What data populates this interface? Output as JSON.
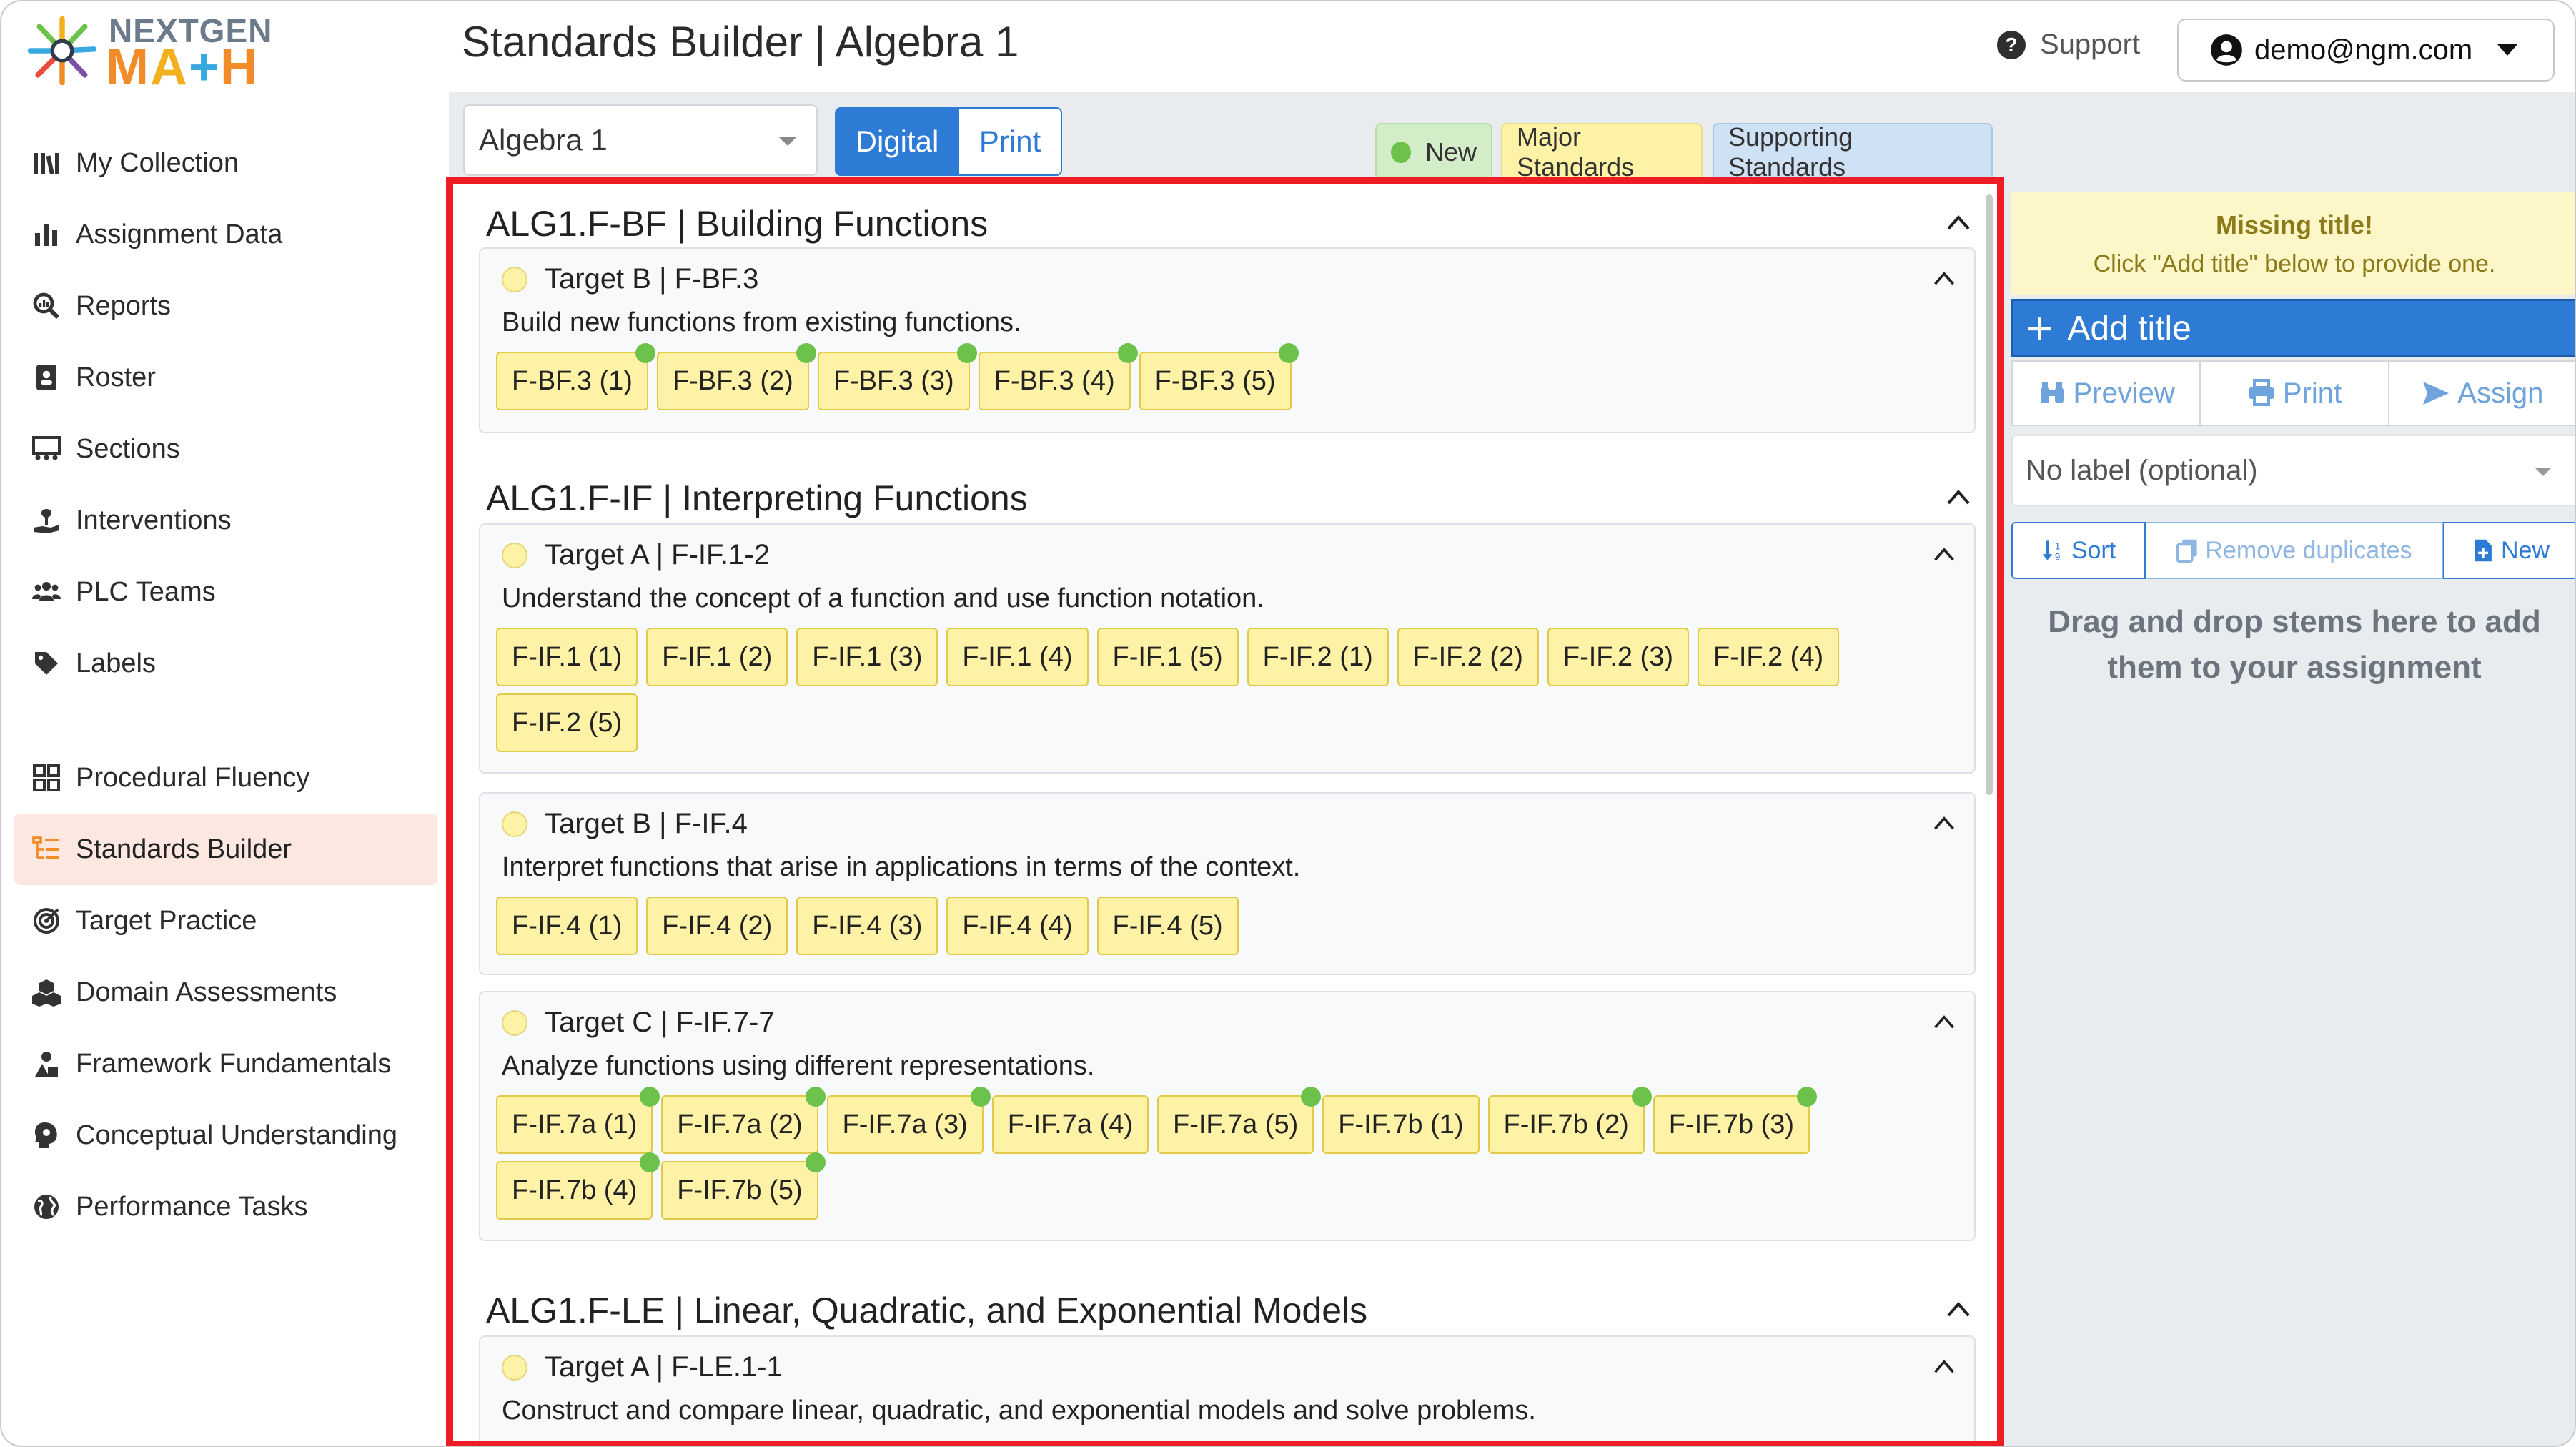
{
  "brand": {
    "line1": "NEXTGEN",
    "line2": [
      "M",
      "A",
      "+",
      "H"
    ]
  },
  "sidebar": {
    "group1": [
      {
        "label": "My Collection",
        "icon": "books-icon"
      },
      {
        "label": "Assignment Data",
        "icon": "bar-chart-icon"
      },
      {
        "label": "Reports",
        "icon": "magnifier-chart-icon"
      },
      {
        "label": "Roster",
        "icon": "id-card-icon"
      },
      {
        "label": "Sections",
        "icon": "sections-icon"
      },
      {
        "label": "Interventions",
        "icon": "hand-seedling-icon"
      },
      {
        "label": "PLC Teams",
        "icon": "users-icon"
      },
      {
        "label": "Labels",
        "icon": "tag-icon"
      }
    ],
    "group2": [
      {
        "label": "Procedural Fluency",
        "icon": "grid-icon"
      },
      {
        "label": "Standards Builder",
        "icon": "list-tree-icon",
        "active": true
      },
      {
        "label": "Target Practice",
        "icon": "target-icon"
      },
      {
        "label": "Domain Assessments",
        "icon": "cubes-icon"
      },
      {
        "label": "Framework Fundamentals",
        "icon": "shapes-icon"
      },
      {
        "label": "Conceptual Understanding",
        "icon": "head-gears-icon"
      },
      {
        "label": "Performance Tasks",
        "icon": "globe-icon"
      }
    ]
  },
  "header": {
    "title": "Standards Builder | Algebra 1",
    "support_label": "Support",
    "user_email": "demo@ngm.com"
  },
  "toolbar": {
    "course": "Algebra 1",
    "mode_digital": "Digital",
    "mode_print": "Print",
    "legend_new": "New",
    "legend_major": "Major Standards",
    "legend_supporting": "Supporting Standards"
  },
  "domains": [
    {
      "title": "ALG1.F-BF | Building Functions",
      "targets": [
        {
          "title": "Target B | F-BF.3",
          "description": "Build new functions from existing functions.",
          "chips": [
            {
              "label": "F-BF.3 (1)",
              "new": true
            },
            {
              "label": "F-BF.3 (2)",
              "new": true
            },
            {
              "label": "F-BF.3 (3)",
              "new": true
            },
            {
              "label": "F-BF.3 (4)",
              "new": true
            },
            {
              "label": "F-BF.3 (5)",
              "new": true
            }
          ]
        }
      ]
    },
    {
      "title": "ALG1.F-IF | Interpreting Functions",
      "targets": [
        {
          "title": "Target A | F-IF.1-2",
          "description": "Understand the concept of a function and use function notation.",
          "chips": [
            {
              "label": "F-IF.1 (1)"
            },
            {
              "label": "F-IF.1 (2)"
            },
            {
              "label": "F-IF.1 (3)"
            },
            {
              "label": "F-IF.1 (4)"
            },
            {
              "label": "F-IF.1 (5)"
            },
            {
              "label": "F-IF.2 (1)"
            },
            {
              "label": "F-IF.2 (2)"
            },
            {
              "label": "F-IF.2 (3)"
            },
            {
              "label": "F-IF.2 (4)"
            },
            {
              "label": "F-IF.2 (5)"
            }
          ]
        },
        {
          "title": "Target B | F-IF.4",
          "description": "Interpret functions that arise in applications in terms of the context.",
          "chips": [
            {
              "label": "F-IF.4 (1)"
            },
            {
              "label": "F-IF.4 (2)"
            },
            {
              "label": "F-IF.4 (3)"
            },
            {
              "label": "F-IF.4 (4)"
            },
            {
              "label": "F-IF.4 (5)"
            }
          ]
        },
        {
          "title": "Target C | F-IF.7-7",
          "description": "Analyze functions using different representations.",
          "chips": [
            {
              "label": "F-IF.7a (1)",
              "new": true
            },
            {
              "label": "F-IF.7a (2)",
              "new": true
            },
            {
              "label": "F-IF.7a (3)",
              "new": true
            },
            {
              "label": "F-IF.7a (4)"
            },
            {
              "label": "F-IF.7a (5)",
              "new": true
            },
            {
              "label": "F-IF.7b (1)"
            },
            {
              "label": "F-IF.7b (2)",
              "new": true
            },
            {
              "label": "F-IF.7b (3)",
              "new": true
            },
            {
              "label": "F-IF.7b (4)",
              "new": true
            },
            {
              "label": "F-IF.7b (5)",
              "new": true
            }
          ]
        }
      ]
    },
    {
      "title": "ALG1.F-LE | Linear, Quadratic, and Exponential Models",
      "targets": [
        {
          "title": "Target A | F-LE.1-1",
          "description": "Construct and compare linear, quadratic, and exponential models and solve problems.",
          "chips": []
        }
      ]
    }
  ],
  "assignment": {
    "missing_title": "Missing title!",
    "missing_hint": "Click \"Add title\" below to provide one.",
    "add_title": "Add title",
    "preview": "Preview",
    "print": "Print",
    "assign": "Assign",
    "label_placeholder": "No label (optional)",
    "sort": "Sort",
    "remove_duplicates": "Remove duplicates",
    "new": "New",
    "drop_hint_1": "Drag and drop stems here to add",
    "drop_hint_2": "them to your assignment"
  },
  "colors": {
    "primary": "#2e7bd6",
    "major": "#fdf2a5",
    "supporting": "#cfe2f5",
    "new": "#6cc24a",
    "highlight": "#ee1c25"
  }
}
